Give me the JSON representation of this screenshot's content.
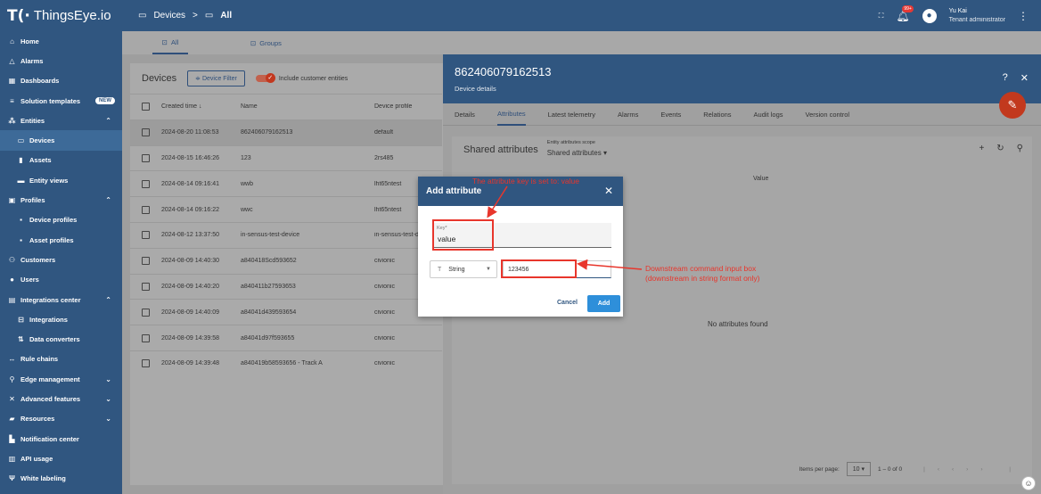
{
  "app": {
    "logo_text": "ThingsEye.io"
  },
  "breadcrumb": {
    "first": "Devices",
    "separator": ">",
    "current": "All"
  },
  "header": {
    "notification_badge": "99+",
    "user_name": "Yu Kai",
    "user_role": "Tenant administrator"
  },
  "sidebar": {
    "items": [
      {
        "label": "Home",
        "icon": "home-icon"
      },
      {
        "label": "Alarms",
        "icon": "alarm-icon"
      },
      {
        "label": "Dashboards",
        "icon": "dashboard-icon"
      },
      {
        "label": "Solution templates",
        "icon": "template-icon",
        "badge": "NEW"
      },
      {
        "label": "Entities",
        "icon": "entities-icon"
      },
      {
        "label": "Devices",
        "icon": "devices-icon"
      },
      {
        "label": "Assets",
        "icon": "assets-icon"
      },
      {
        "label": "Entity views",
        "icon": "entity-views-icon"
      },
      {
        "label": "Profiles",
        "icon": "profiles-icon"
      },
      {
        "label": "Device profiles",
        "icon": "device-profiles-icon"
      },
      {
        "label": "Asset profiles",
        "icon": "asset-profiles-icon"
      },
      {
        "label": "Customers",
        "icon": "customers-icon"
      },
      {
        "label": "Users",
        "icon": "users-icon"
      },
      {
        "label": "Integrations center",
        "icon": "integrations-center-icon"
      },
      {
        "label": "Integrations",
        "icon": "integrations-icon"
      },
      {
        "label": "Data converters",
        "icon": "data-converters-icon"
      },
      {
        "label": "Rule chains",
        "icon": "rule-chains-icon"
      },
      {
        "label": "Edge management",
        "icon": "edge-icon"
      },
      {
        "label": "Advanced features",
        "icon": "advanced-icon"
      },
      {
        "label": "Resources",
        "icon": "resources-icon"
      },
      {
        "label": "Notification center",
        "icon": "notification-center-icon"
      },
      {
        "label": "API usage",
        "icon": "api-usage-icon"
      },
      {
        "label": "White labeling",
        "icon": "white-labeling-icon"
      }
    ]
  },
  "main_tabs": {
    "all": "All",
    "groups": "Groups"
  },
  "devices": {
    "title": "Devices",
    "filter_button": "Device Filter",
    "include_customer": "Include customer entities",
    "columns": {
      "created": "Created time",
      "name": "Name",
      "profile": "Device profile"
    },
    "rows": [
      {
        "created": "2024-08-20 11:08:53",
        "name": "862406079162513",
        "profile": "default"
      },
      {
        "created": "2024-08-15 16:46:26",
        "name": "123",
        "profile": "2rs485"
      },
      {
        "created": "2024-08-14 09:16:41",
        "name": "wwb",
        "profile": "lht65ntest"
      },
      {
        "created": "2024-08-14 09:16:22",
        "name": "wwc",
        "profile": "lht65ntest"
      },
      {
        "created": "2024-08-12 13:37:50",
        "name": "in-sensus-test-device",
        "profile": "in-sensus-test-d"
      },
      {
        "created": "2024-08-09 14:40:30",
        "name": "a840418Scd593652",
        "profile": "civionic"
      },
      {
        "created": "2024-08-09 14:40:20",
        "name": "a840411b27593653",
        "profile": "civionic"
      },
      {
        "created": "2024-08-09 14:40:09",
        "name": "a84041d439593654",
        "profile": "civionic"
      },
      {
        "created": "2024-08-09 14:39:58",
        "name": "a84041d97f593655",
        "profile": "civionic"
      },
      {
        "created": "2024-08-09 14:39:48",
        "name": "a840419b58593656 - Track A",
        "profile": "civionic"
      }
    ]
  },
  "details": {
    "title": "862406079162513",
    "subtitle": "Device details",
    "tabs": [
      "Details",
      "Attributes",
      "Latest telemetry",
      "Alarms",
      "Events",
      "Relations",
      "Audit logs",
      "Version control"
    ],
    "attributes": {
      "title": "Shared attributes",
      "scope_label": "Entity attributes scope",
      "scope_value": "Shared attributes",
      "value_col": "Value",
      "empty": "No attributes found",
      "items_per_page_label": "Items per page:",
      "items_per_page": "10",
      "range": "1 – 0 of 0"
    }
  },
  "dialog": {
    "title": "Add attribute",
    "key_label": "Key*",
    "key_value": "value",
    "type": "String",
    "value_input": "123456",
    "cancel": "Cancel",
    "add": "Add"
  },
  "annotations": {
    "key_note": "The attribute key is set to: value",
    "input_note_line1": "Downstream command input box",
    "input_note_line2": "(downstream in string format only)",
    "color": "#e8362c"
  }
}
